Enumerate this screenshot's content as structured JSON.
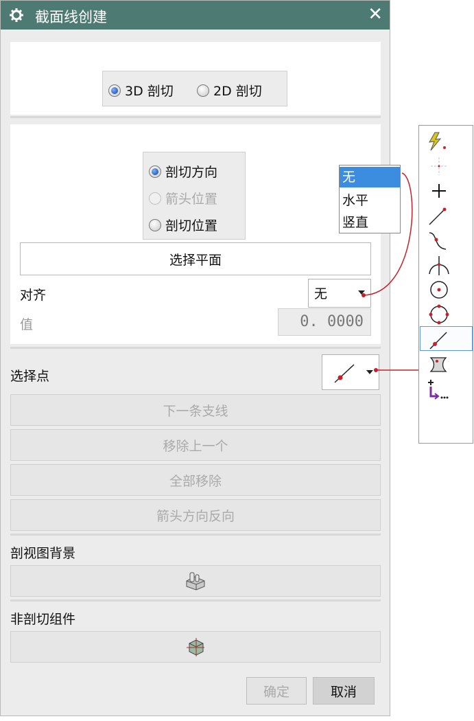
{
  "window": {
    "title": "截面线创建",
    "close": "✕"
  },
  "mode": {
    "options": [
      "3D 剖切",
      "2D 剖切"
    ],
    "selected": "3D 剖切"
  },
  "step": {
    "options": [
      "剖切方向",
      "箭头位置",
      "剖切位置"
    ],
    "selected": "剖切方向",
    "disabled": [
      "箭头位置"
    ]
  },
  "select_plane": "选择平面",
  "align": {
    "label": "对齐",
    "value": "无",
    "options": [
      "无",
      "水平",
      "竖直"
    ]
  },
  "value": {
    "label": "值",
    "value": "0. 0000"
  },
  "select_point": {
    "label": "选择点",
    "icon": "point-on-curve-icon"
  },
  "buttons": {
    "next_branch": "下一条支线",
    "remove_last": "移除上一个",
    "remove_all": "全部移除",
    "reverse_arrow": "箭头方向反向"
  },
  "section_background": {
    "label": "剖视图背景",
    "icon": "solid-body-icon"
  },
  "non_section": {
    "label": "非剖切组件",
    "icon": "component-cube-icon"
  },
  "footer": {
    "ok": "确定",
    "cancel": "取消"
  },
  "palette": {
    "items": [
      "inferred-point-icon",
      "cursor-location-icon",
      "existing-point-icon",
      "end-point-icon",
      "control-point-icon",
      "intersection-point-icon",
      "arc-center-icon",
      "quadrant-point-icon",
      "point-on-curve-icon",
      "point-on-face-icon",
      "point-constructor-icon"
    ],
    "selected": "point-on-curve-icon"
  },
  "colors": {
    "titlebar": "#4d7b73",
    "connector": "#c8202a",
    "menu_highlight": "#3c8de0"
  }
}
